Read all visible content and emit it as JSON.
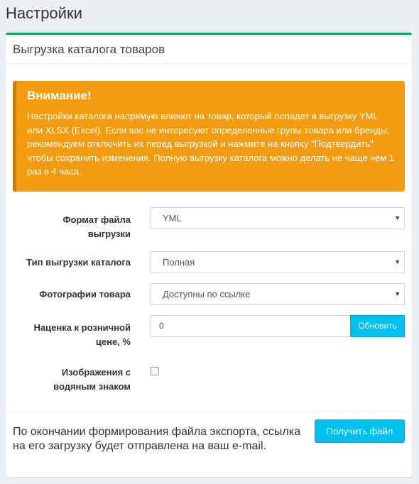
{
  "page": {
    "title": "Настройки"
  },
  "box": {
    "title": "Выгрузка каталога товаров"
  },
  "callout": {
    "heading": "Внимание!",
    "text": "Настройки каталога напрямую влияют на товар, который попадет в выгрузку YML или XLSX (Excel). Если вас не интересуют определенные групы товара или бренды, рекомендуем отключить их перед выгрузкой и нажмите на кнопку \"Подтвердить\" чтобы сохранить изменения. Полную выгрузку каталога можно делать не чаще чем 1 раз в 4 часа."
  },
  "form": {
    "format": {
      "label_line1": "Формат файла",
      "label_line2": "выгрузки",
      "value": "YML"
    },
    "type": {
      "label": "Тип выгрузки каталога",
      "value": "Полная"
    },
    "photos": {
      "label": "Фотографии товара",
      "value": "Доступны по ссылке"
    },
    "markup": {
      "label_line1": "Наценка к розничной",
      "label_line2": "цене, %",
      "value": "0",
      "button": "Обновить"
    },
    "watermark": {
      "label_line1": "Изображения с",
      "label_line2": "водяным знаком",
      "checked": false
    }
  },
  "footer": {
    "text": "По окончании формирования файла экспорта, ссылка на его загрузку будет отправлена на ваш e-mail.",
    "button": "Получить файл"
  },
  "colors": {
    "accent": "#00c0ef",
    "warning": "#f39c12",
    "box_border": "#00a65a"
  }
}
